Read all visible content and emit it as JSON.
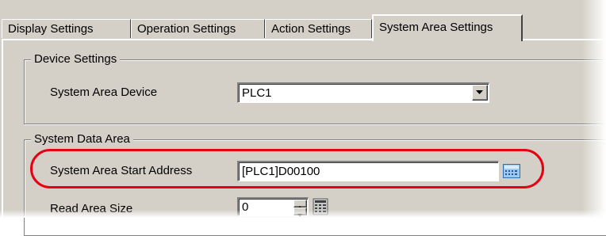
{
  "tabs": [
    {
      "label": "Display Settings",
      "active": false
    },
    {
      "label": "Operation Settings",
      "active": false
    },
    {
      "label": "Action Settings",
      "active": false
    },
    {
      "label": "System Area Settings",
      "active": true
    }
  ],
  "device_settings": {
    "title": "Device Settings",
    "system_area_device_label": "System Area Device",
    "system_area_device_value": "PLC1"
  },
  "system_data_area": {
    "title": "System Data Area",
    "start_address_label": "System Area Start Address",
    "start_address_value": "[PLC1]D00100",
    "read_area_size_label": "Read Area Size",
    "read_area_size_value": "0"
  },
  "icons": {
    "address_picker": "keypad-icon",
    "dropdown": "chevron-down-icon",
    "numeric_keypad": "numeric-keypad-icon"
  },
  "colors": {
    "highlight": "#e60012",
    "dialog_background": "#d4d0c8"
  }
}
